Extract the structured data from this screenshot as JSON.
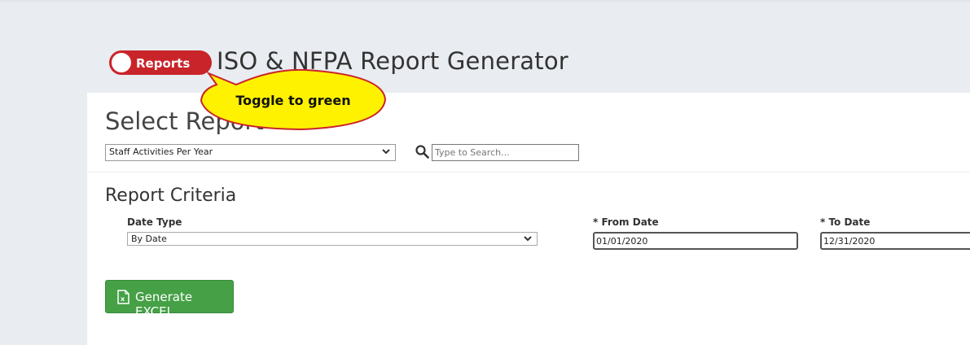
{
  "header": {
    "toggle_label": "Reports",
    "title": "ISO & NFPA Report Generator"
  },
  "select_report": {
    "title": "Select Report",
    "selected": "Staff Activities Per Year",
    "search_placeholder": "Type to Search..."
  },
  "criteria": {
    "title": "Report Criteria",
    "date_type_label": "Date Type",
    "date_type_value": "By Date",
    "from_label": "* From Date",
    "from_value": "01/01/2020",
    "to_label": "* To Date",
    "to_value": "12/31/2020"
  },
  "actions": {
    "generate_label": "Generate EXCEL"
  },
  "callout": {
    "text": "Toggle to green"
  },
  "colors": {
    "toggle": "#c9242a",
    "button": "#45a046",
    "callout_fill": "#fff200",
    "callout_border": "#c9242a"
  }
}
